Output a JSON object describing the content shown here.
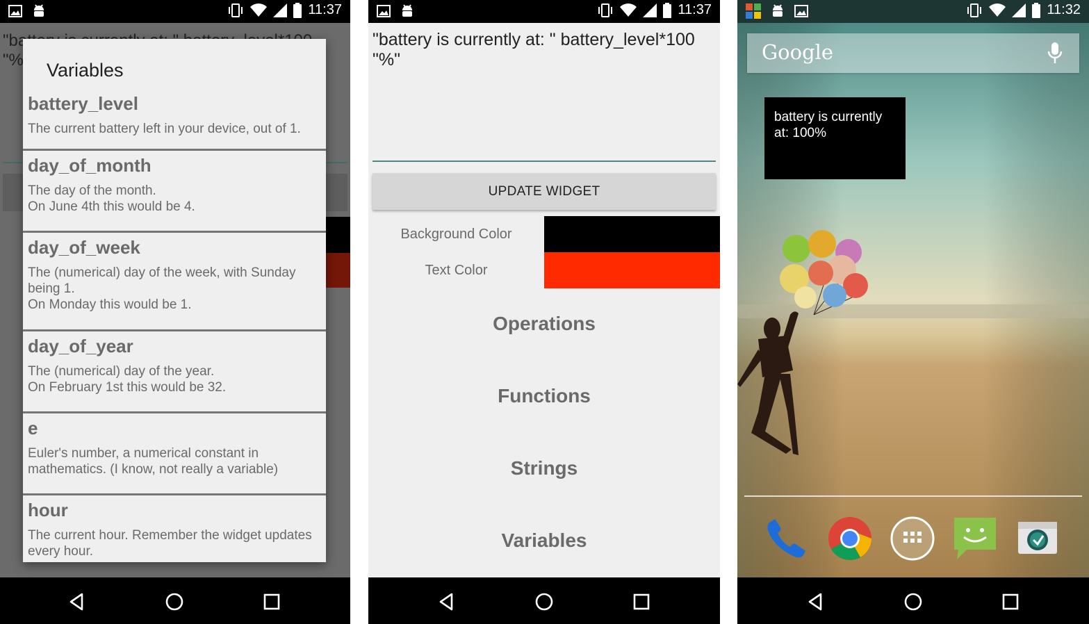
{
  "status_bars": [
    {
      "time": "11:37"
    },
    {
      "time": "11:37"
    },
    {
      "time": "11:32"
    }
  ],
  "screen1": {
    "background_formula": "\"battery is currently at: \" battery_level*100\n\"%\"",
    "dialog_title": "Variables",
    "variables": [
      {
        "name": "battery_level",
        "description": "The current battery left in your device, out of 1."
      },
      {
        "name": "day_of_month",
        "description": "The day of the month.\nOn June 4th this would be 4."
      },
      {
        "name": "day_of_week",
        "description": "The (numerical) day of the week, with Sunday being 1.\nOn Monday this would be 1."
      },
      {
        "name": "day_of_year",
        "description": "The (numerical) day of the year.\nOn February 1st this would be 32."
      },
      {
        "name": "e",
        "description": "Euler's number, a numerical constant in mathematics. (I know, not really a variable)"
      },
      {
        "name": "hour",
        "description": "The current hour. Remember the widget updates every hour."
      }
    ]
  },
  "screen2": {
    "formula": "\"battery is currently at: \" battery_level*100 \"%\"",
    "update_button": "UPDATE WIDGET",
    "colors": [
      {
        "label": "Background Color",
        "value": "#000000"
      },
      {
        "label": "Text Color",
        "value": "#ff2a00"
      }
    ],
    "menu": [
      "Operations",
      "Functions",
      "Strings",
      "Variables"
    ]
  },
  "screen3": {
    "search_logo": "Google",
    "widget_text": "battery is currently at: 100%",
    "dock": [
      "phone-icon",
      "chrome-icon",
      "app-drawer-icon",
      "messenger-icon",
      "camera-icon"
    ]
  }
}
